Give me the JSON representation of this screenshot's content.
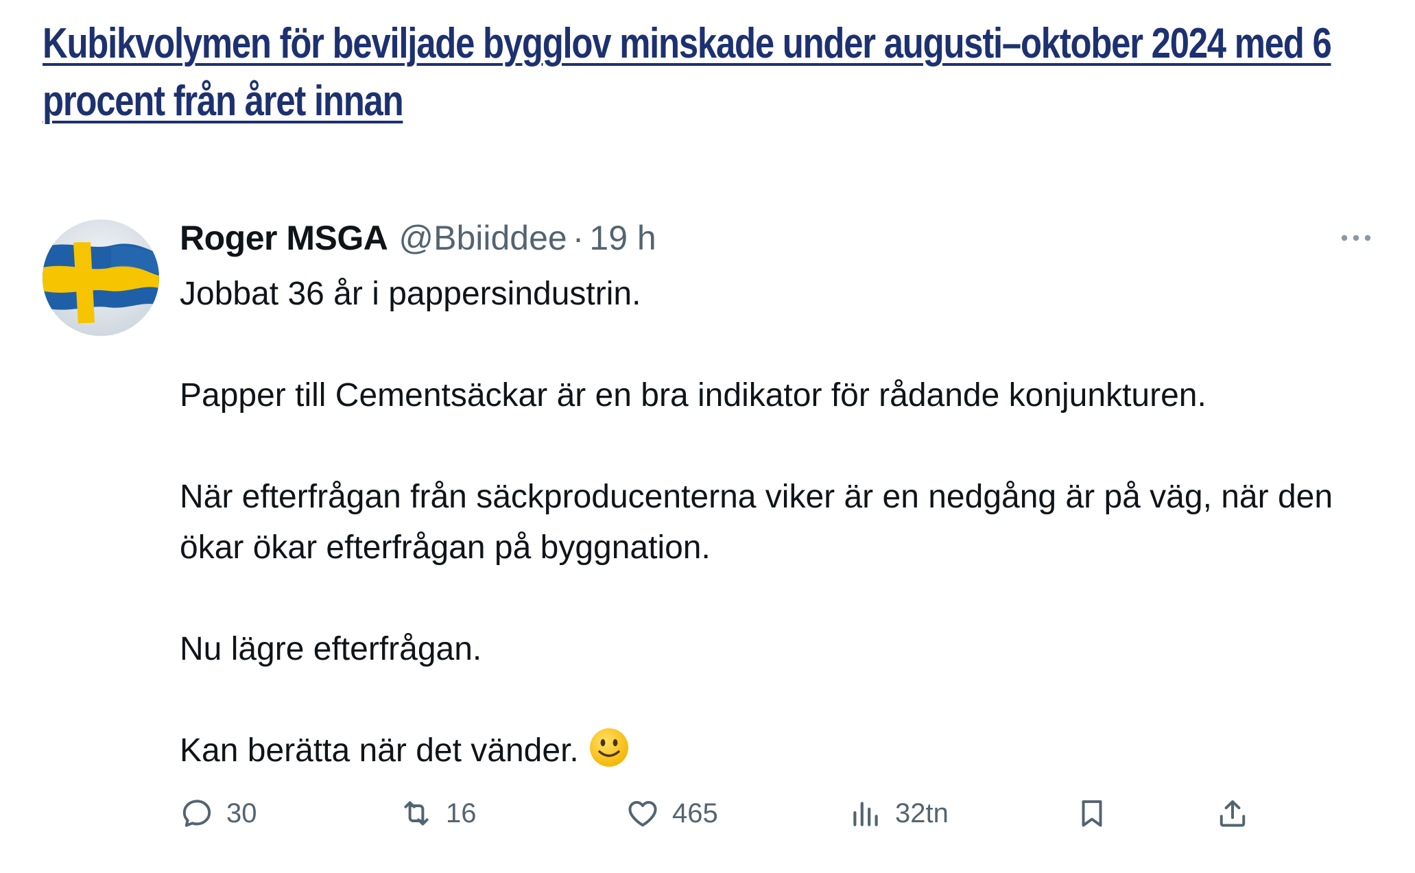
{
  "headline": {
    "text": "Kubikvolymen för beviljade bygglov minskade under augusti–oktober 2024 med 6 procent från året innan"
  },
  "tweet": {
    "display_name": "Roger MSGA",
    "handle": "@Bbiiddee",
    "separator": "·",
    "time": "19 h",
    "avatar_icon": "swedish-flag-icon",
    "paragraphs": [
      "Jobbat 36 år i pappersindustrin.",
      "Papper till Cementsäckar är en bra indikator för rådande konjunkturen.",
      "När efterfrågan från säckproducenterna viker är en nedgång är på väg, när den ökar ökar efterfrågan på byggnation.",
      "Nu lägre efterfrågan.",
      "Kan berätta när det vänder."
    ],
    "trailing_emoji": "slightly-smiling-face-icon",
    "actions": {
      "replies": "30",
      "retweets": "16",
      "likes": "465",
      "views": "32tn"
    }
  },
  "colors": {
    "headline": "#1d3170",
    "text": "#0f1419",
    "muted": "#536471",
    "flag_blue": "#1f5fa8",
    "flag_yellow": "#f6c400"
  }
}
